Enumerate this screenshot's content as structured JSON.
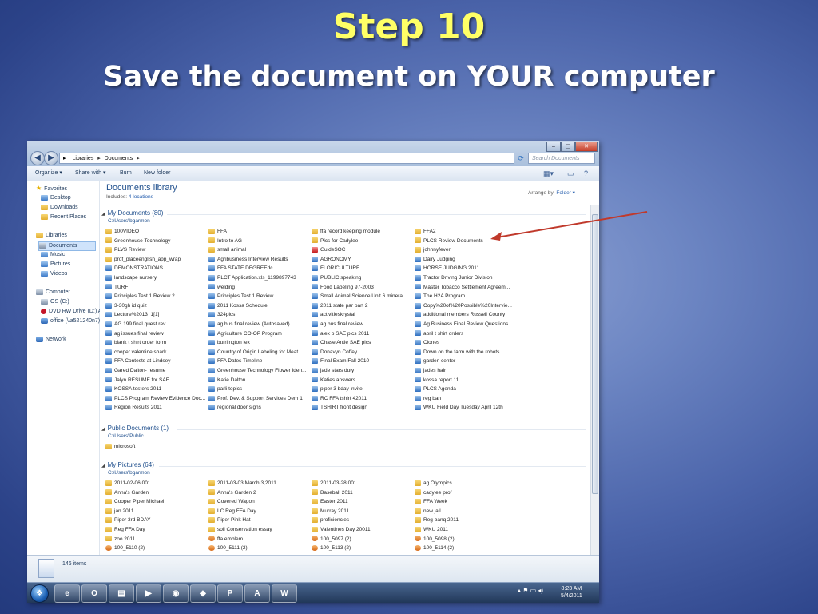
{
  "slide": {
    "title": "Step 10",
    "subtitle": "Save the document on YOUR computer"
  },
  "explorer": {
    "address": {
      "crumbs": [
        "Libraries",
        "Documents"
      ]
    },
    "search_placeholder": "Search Documents",
    "toolbar": {
      "organize": "Organize ▾",
      "share_with": "Share with ▾",
      "burn": "Burn",
      "new_folder": "New folder"
    },
    "nav": {
      "favorites": "Favorites",
      "desktop": "Desktop",
      "downloads": "Downloads",
      "recent_places": "Recent Places",
      "libraries": "Libraries",
      "documents": "Documents",
      "music": "Music",
      "pictures": "Pictures",
      "videos": "Videos",
      "computer": "Computer",
      "os_c": "OS (C:)",
      "dvd": "DVD RW Drive (D:) A",
      "office": "office (\\\\a521240n7)",
      "network": "Network"
    },
    "library": {
      "title": "Documents library",
      "includes_label": "Includes:",
      "includes_link": "4 locations",
      "arrange_label": "Arrange by:",
      "arrange_value": "Folder ▾"
    },
    "groups": {
      "my_documents": {
        "title": "My Documents (80)",
        "path": "C:\\Users\\bgarmon",
        "columns": [
          [
            {
              "name": "100VIDEO",
              "icon": "folder"
            },
            {
              "name": "Greenhouse Technology",
              "icon": "folder"
            },
            {
              "name": "PLVS Review",
              "icon": "folder"
            },
            {
              "name": "prof_placeenglish_app_wrap",
              "icon": "folder"
            },
            {
              "name": "DEMONSTRATIONS",
              "icon": "doc"
            },
            {
              "name": "landscape nursery",
              "icon": "doc"
            },
            {
              "name": "TURF",
              "icon": "doc"
            },
            {
              "name": "Principles Test 1 Review 2",
              "icon": "doc"
            },
            {
              "name": "3-30gh id quiz",
              "icon": "doc"
            },
            {
              "name": "Lecture%2013_1[1]",
              "icon": "doc"
            },
            {
              "name": "AG 199 final quest rev",
              "icon": "doc"
            },
            {
              "name": "ag issues final review",
              "icon": "doc"
            },
            {
              "name": "blank t shirt order form",
              "icon": "doc"
            },
            {
              "name": "cooper valentine shark",
              "icon": "doc"
            },
            {
              "name": "FFA Contests at Lindsey",
              "icon": "doc"
            },
            {
              "name": "Gared Dalton- resume",
              "icon": "doc"
            },
            {
              "name": "Jalyn RESUME for SAE",
              "icon": "doc"
            },
            {
              "name": "KOSSA testers 2011",
              "icon": "doc"
            },
            {
              "name": "PLCS Program Review Evidence Doc...",
              "icon": "doc"
            },
            {
              "name": "Region Results 2011",
              "icon": "doc"
            }
          ],
          [
            {
              "name": "FFA",
              "icon": "folder"
            },
            {
              "name": "Intro to AG",
              "icon": "folder"
            },
            {
              "name": "small animal",
              "icon": "folder"
            },
            {
              "name": "Agribusiness Interview Results",
              "icon": "doc"
            },
            {
              "name": "FFA STATE DEGREEdc",
              "icon": "doc"
            },
            {
              "name": "PLCT Application.xls_1199897743",
              "icon": "doc"
            },
            {
              "name": "welding",
              "icon": "doc"
            },
            {
              "name": "Principles Test 1 Review",
              "icon": "doc"
            },
            {
              "name": "2011 Kossa Schedule",
              "icon": "doc"
            },
            {
              "name": "324pics",
              "icon": "doc"
            },
            {
              "name": "ag bus final review (Autosaved)",
              "icon": "doc"
            },
            {
              "name": "Agriculture CO-OP Program",
              "icon": "doc"
            },
            {
              "name": "burrlington lex",
              "icon": "doc"
            },
            {
              "name": "Country of Origin Labeling for Meat ...",
              "icon": "doc"
            },
            {
              "name": "FFA Dates  Timeline",
              "icon": "doc"
            },
            {
              "name": "Greenhouse Technology Flower Iden...",
              "icon": "doc"
            },
            {
              "name": "Katie Dalton",
              "icon": "doc"
            },
            {
              "name": "parli topics",
              "icon": "doc"
            },
            {
              "name": "Prof. Dev. & Support Services Dem 1",
              "icon": "doc"
            },
            {
              "name": "regional door signs",
              "icon": "doc"
            }
          ],
          [
            {
              "name": "ffa record keeping module",
              "icon": "folder"
            },
            {
              "name": "Pics for Cadylee",
              "icon": "folder"
            },
            {
              "name": "GuideSOC",
              "icon": "pdf"
            },
            {
              "name": "AGRONOMY",
              "icon": "doc"
            },
            {
              "name": "FLORICULTURE",
              "icon": "doc"
            },
            {
              "name": "PUBLIC speaking",
              "icon": "doc"
            },
            {
              "name": "Food Labeling 97-2003",
              "icon": "doc"
            },
            {
              "name": "Small Animal Science Unit 6 mineral ...",
              "icon": "doc"
            },
            {
              "name": "2011 state par part 2",
              "icon": "doc"
            },
            {
              "name": "activitieskrystal",
              "icon": "doc"
            },
            {
              "name": "ag bus final review",
              "icon": "doc"
            },
            {
              "name": "alex p SAE pics 2011",
              "icon": "doc"
            },
            {
              "name": "Chase Antle SAE pics",
              "icon": "doc"
            },
            {
              "name": "Donavyn Coffey",
              "icon": "doc"
            },
            {
              "name": "Final Exam Fall 2010",
              "icon": "doc"
            },
            {
              "name": "jade stars duty",
              "icon": "doc"
            },
            {
              "name": "Katies answers",
              "icon": "doc"
            },
            {
              "name": "piper 3 bday invite",
              "icon": "doc"
            },
            {
              "name": "RC FFA tshirt 42011",
              "icon": "doc"
            },
            {
              "name": "TSHIRT front design",
              "icon": "doc"
            }
          ],
          [
            {
              "name": "FFA2",
              "icon": "folder"
            },
            {
              "name": "PLCS Review Documents",
              "icon": "folder"
            },
            {
              "name": "johnnyfever",
              "icon": "folder"
            },
            {
              "name": "Dairy Judging",
              "icon": "doc"
            },
            {
              "name": "HORSE JUDGING 2011",
              "icon": "doc"
            },
            {
              "name": "Tractor Driving Junior Division",
              "icon": "doc"
            },
            {
              "name": "Master Tobacco Settlement Agreem...",
              "icon": "doc"
            },
            {
              "name": "The H2A Program",
              "icon": "doc"
            },
            {
              "name": "Copy%20of%20Possible%20Intervie...",
              "icon": "doc"
            },
            {
              "name": "additional members Russell County",
              "icon": "doc"
            },
            {
              "name": "Ag Business Final Review Questions ...",
              "icon": "doc"
            },
            {
              "name": "april t shirt orders",
              "icon": "doc"
            },
            {
              "name": "Clones",
              "icon": "doc"
            },
            {
              "name": "Down on the farm with the robots",
              "icon": "doc"
            },
            {
              "name": "garden center",
              "icon": "doc"
            },
            {
              "name": "jades hair",
              "icon": "doc"
            },
            {
              "name": "kossa report 11",
              "icon": "doc"
            },
            {
              "name": "PLCS Agenda",
              "icon": "doc"
            },
            {
              "name": "reg ban",
              "icon": "doc"
            },
            {
              "name": "WKU Field Day Tuesday April 12th",
              "icon": "doc"
            }
          ]
        ]
      },
      "public_documents": {
        "title": "Public Documents (1)",
        "path": "C:\\Users\\Public",
        "items": [
          {
            "name": "microsoft",
            "icon": "folder"
          }
        ]
      },
      "my_pictures": {
        "title": "My Pictures (64)",
        "path": "C:\\Users\\bgarmon",
        "columns": [
          [
            {
              "name": "2011-02-06 001",
              "icon": "folder"
            },
            {
              "name": "Anna's Garden",
              "icon": "folder"
            },
            {
              "name": "Cooper Piper Michael",
              "icon": "folder"
            },
            {
              "name": "jan 2011",
              "icon": "folder"
            },
            {
              "name": "Piper 3rd BDAY",
              "icon": "folder"
            },
            {
              "name": "Reg FFA Day",
              "icon": "folder"
            },
            {
              "name": "zoo 2011",
              "icon": "folder"
            },
            {
              "name": "100_5110 (2)",
              "icon": "img"
            }
          ],
          [
            {
              "name": "2011-03-03 March 3,2011",
              "icon": "folder"
            },
            {
              "name": "Anna's Garden 2",
              "icon": "folder"
            },
            {
              "name": "Covered Wagon",
              "icon": "folder"
            },
            {
              "name": "LC Reg FFA Day",
              "icon": "folder"
            },
            {
              "name": "Piper Pink Hat",
              "icon": "folder"
            },
            {
              "name": "soil Conservation essay",
              "icon": "folder"
            },
            {
              "name": "ffa emblem",
              "icon": "img"
            },
            {
              "name": "100_5111 (2)",
              "icon": "img"
            }
          ],
          [
            {
              "name": "2011-03-28 001",
              "icon": "folder"
            },
            {
              "name": "Baseball 2011",
              "icon": "folder"
            },
            {
              "name": "Easter 2011",
              "icon": "folder"
            },
            {
              "name": "Murray 2011",
              "icon": "folder"
            },
            {
              "name": "proficiencies",
              "icon": "folder"
            },
            {
              "name": "Valentines Day 20011",
              "icon": "folder"
            },
            {
              "name": "100_5097 (2)",
              "icon": "img"
            },
            {
              "name": "100_5113 (2)",
              "icon": "img"
            }
          ],
          [
            {
              "name": "ag Olympics",
              "icon": "folder"
            },
            {
              "name": "cadylee prof",
              "icon": "folder"
            },
            {
              "name": "FFA Week",
              "icon": "folder"
            },
            {
              "name": "new jail",
              "icon": "folder"
            },
            {
              "name": "Reg banq 2011",
              "icon": "folder"
            },
            {
              "name": "WKU 2011",
              "icon": "folder"
            },
            {
              "name": "100_5098 (2)",
              "icon": "img"
            },
            {
              "name": "100_5114 (2)",
              "icon": "img"
            }
          ]
        ]
      }
    },
    "status": {
      "count": "146 items"
    },
    "taskbar": {
      "apps": [
        "e",
        "O",
        "▤",
        "▶",
        "◉",
        "◆",
        "P",
        "A",
        "W"
      ],
      "tray_icons": "▴ ⚑ ▭ ◂)",
      "time": "8:23 AM",
      "date": "5/4/2011"
    }
  },
  "colors": {
    "annotation_arrow": "#c0392b",
    "title_yellow": "#ffff66"
  }
}
